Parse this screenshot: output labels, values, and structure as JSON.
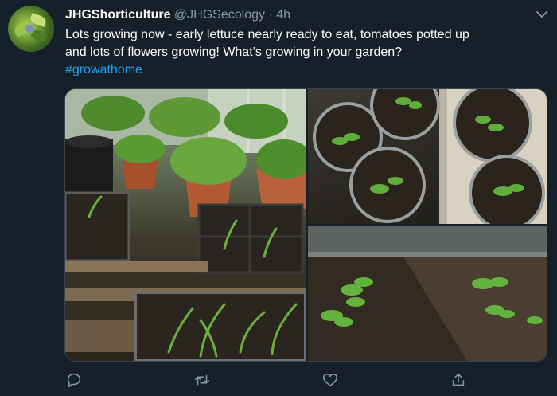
{
  "author": {
    "display_name": "JHGShorticulture",
    "handle": "@JHGSecology",
    "separator": "·",
    "time": "4h"
  },
  "tweet": {
    "line1": "Lots growing now - early lettuce nearly ready to eat, tomatoes potted up",
    "line2": "and lots of flowers growing! What’s growing in your garden?",
    "hashtag": "#growathome"
  },
  "media": {
    "photos": [
      {
        "subject": "greenhouse seedlings in pots and trays"
      },
      {
        "subject": "tomato seedlings in pots"
      },
      {
        "subject": "young plants in soil bed"
      }
    ]
  },
  "actions": {
    "icons": [
      "reply-icon",
      "retweet-icon",
      "like-icon",
      "share-icon"
    ]
  },
  "colors": {
    "background": "#15202b",
    "text": "#ffffff",
    "muted": "#8899a6",
    "accent": "#1da1f2"
  }
}
